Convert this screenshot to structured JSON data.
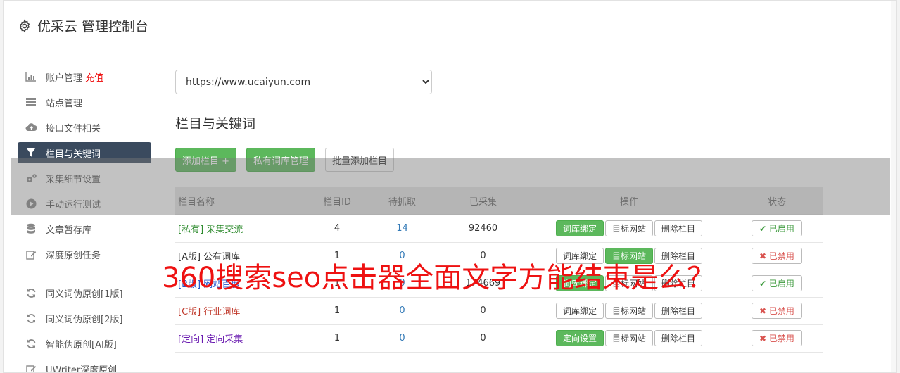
{
  "header": {
    "title": "优采云 管理控制台"
  },
  "sidebar": {
    "items": [
      {
        "label": "账户管理",
        "extra": "充值",
        "icon": "bar-chart-icon"
      },
      {
        "label": "站点管理",
        "icon": "server-icon"
      },
      {
        "label": "接口文件相关",
        "icon": "cloud-upload-icon"
      },
      {
        "label": "栏目与关键词",
        "icon": "filter-icon",
        "active": true
      },
      {
        "label": "采集细节设置",
        "icon": "gears-icon"
      },
      {
        "label": "手动运行测试",
        "icon": "play-icon"
      },
      {
        "label": "文章暂存库",
        "icon": "database-icon"
      },
      {
        "label": "深度原创任务",
        "icon": "edit-icon"
      }
    ],
    "items2": [
      {
        "label": "同义词伪原创[1版]",
        "icon": "refresh-icon"
      },
      {
        "label": "同义词伪原创[2版]",
        "icon": "refresh-icon"
      },
      {
        "label": "智能伪原创[AI版]",
        "icon": "refresh-icon"
      },
      {
        "label": "UWriter深度原创",
        "icon": "edit-icon"
      }
    ]
  },
  "main": {
    "site_select": {
      "value": "https://www.ucaiyun.com"
    },
    "section_title": "栏目与关键词",
    "buttons": {
      "add": "添加栏目 +",
      "private_lib": "私有词库管理",
      "batch_add": "批量添加栏目"
    },
    "table": {
      "headers": [
        "栏目名称",
        "栏目ID",
        "待抓取",
        "已采集",
        "操作",
        "状态"
      ],
      "rows": [
        {
          "name": "[私有] 采集交流",
          "name_color": "#2e8b2e",
          "id": "4",
          "pending": "14",
          "collected": "92460",
          "op1": "词库绑定",
          "op1_green": true,
          "op2": "目标网站",
          "op2_green": false,
          "op3": "删除栏目",
          "status": "已启用",
          "status_on": true
        },
        {
          "name": "[A版] 公有词库",
          "name_color": "#333333",
          "id": "1",
          "pending": "0",
          "collected": "0",
          "op1": "词库绑定",
          "op1_green": false,
          "op2": "目标网站",
          "op2_green": true,
          "op3": "删除栏目",
          "status": "已禁用",
          "status_on": false
        },
        {
          "name": "[B版] 网站百度",
          "name_color": "#2255cc",
          "id": "1",
          "pending": "0",
          "collected": "174669",
          "op1": "词库绑定",
          "op1_green": true,
          "op2": "目标网站",
          "op2_green": false,
          "op3": "删除栏目",
          "status": "已启用",
          "status_on": true
        },
        {
          "name": "[C版] 行业词库",
          "name_color": "#c0392b",
          "id": "1",
          "pending": "0",
          "collected": "0",
          "op1": "词库绑定",
          "op1_green": false,
          "op2": "目标网站",
          "op2_green": false,
          "op3": "删除栏目",
          "status": "已禁用",
          "status_on": false
        },
        {
          "name": "[定向] 定向采集",
          "name_color": "#6a1bb0",
          "id": "1",
          "pending": "0",
          "collected": "0",
          "op1": "定向设置",
          "op1_green": true,
          "op2": "目标网站",
          "op2_green": false,
          "op3": "删除栏目",
          "status": "已禁用",
          "status_on": false
        }
      ]
    }
  },
  "overlay": {
    "text": "360搜索seo点击器全面文字方能结束是么？"
  },
  "colors": {
    "accent_green": "#5cb85c",
    "active_nav": "#3a4a5e",
    "overlay_red": "#ee1111"
  }
}
